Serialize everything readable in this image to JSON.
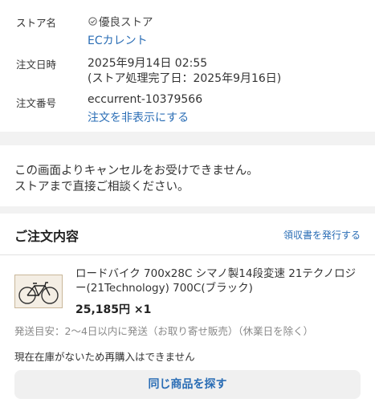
{
  "store": {
    "label": "ストア名",
    "badge_text": "優良ストア",
    "name": "ECカレント"
  },
  "order_date": {
    "label": "注文日時",
    "value": "2025年9月14日 02:55",
    "completed": "(ストア処理完了日：2025年9月16日)"
  },
  "order_number": {
    "label": "注文番号",
    "value": "eccurrent-10379566",
    "hide_link": "注文を非表示にする"
  },
  "notice": {
    "line1": "この画面よりキャンセルをお受けできません。",
    "line2": "ストアまで直接ご相談ください。"
  },
  "order": {
    "title": "ご注文内容",
    "receipt_link": "領収書を発行する",
    "item": {
      "name": "ロードバイク 700x28C シマノ製14段変速 21テクノロジー(21Technology) 700C(ブラック)",
      "price": "25,185円 ×1",
      "shipping": "発送目安：2〜4日以内に発送（お取り寄せ販売）（休業日を除く）",
      "thumbnail_icon": "bicycle-icon"
    },
    "stock_note": "現在在庫がないため再購入はできません",
    "find_button": "同じ商品を探す"
  },
  "colors": {
    "link": "#2a6db5"
  }
}
